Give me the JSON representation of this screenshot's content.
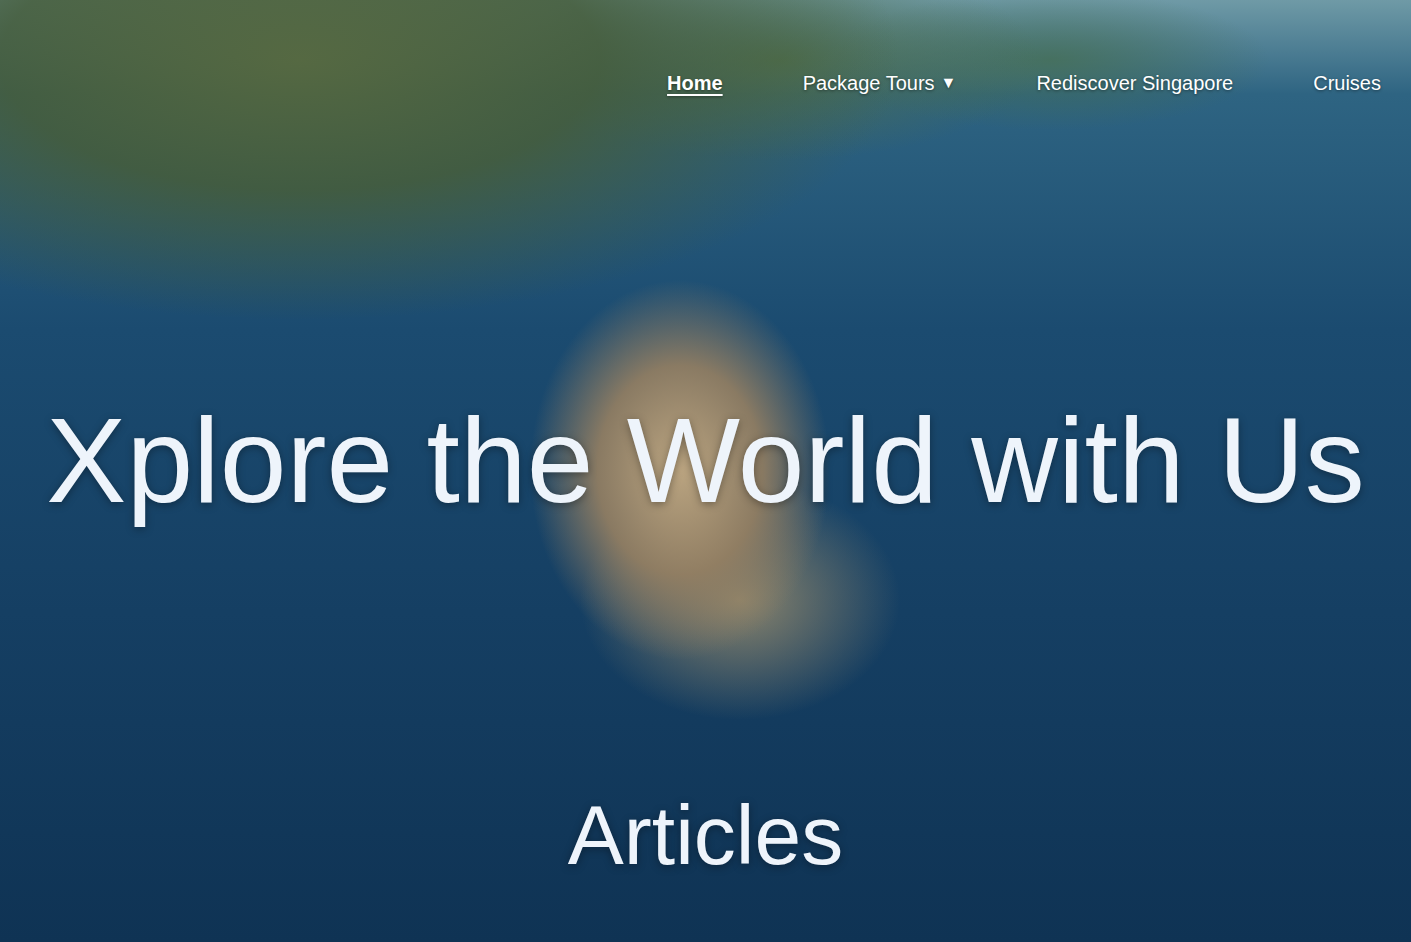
{
  "nav": {
    "items": [
      {
        "label": "Home",
        "selected": true
      },
      {
        "label": "Package Tours",
        "selected": false,
        "caret": "▼"
      },
      {
        "label": "Rediscover Singapore",
        "selected": false
      },
      {
        "label": "Cruises",
        "selected": false
      }
    ]
  },
  "hero": {
    "title": "Xplore the World with Us"
  },
  "section": {
    "title": "Articles"
  }
}
